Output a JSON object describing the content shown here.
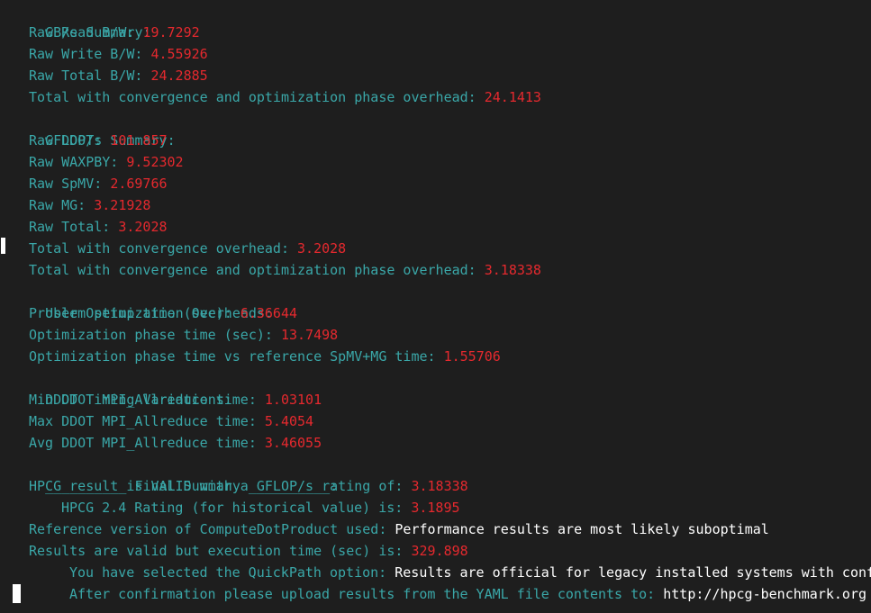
{
  "colors": {
    "background": "#1e1e1e",
    "key": "#3aa7a8",
    "value": "#e5292e",
    "plain": "#ffffff"
  },
  "lines": {
    "gbs_header": "GB/s Summary:",
    "raw_read_label": "Raw Read B/W: ",
    "raw_read_value": "19.7292",
    "raw_write_label": "Raw Write B/W: ",
    "raw_write_value": "4.55926",
    "raw_total_bw_label": "Raw Total B/W: ",
    "raw_total_bw_value": "24.2885",
    "gbs_total_opt_label": "Total with convergence and optimization phase overhead: ",
    "gbs_total_opt_value": "24.1413",
    "gflops_header": "GFLOP/s Summary:",
    "raw_ddot_label": "Raw DDOT: ",
    "raw_ddot_value": "101.857",
    "raw_waxpby_label": "Raw WAXPBY: ",
    "raw_waxpby_value": "9.52302",
    "raw_spmv_label": "Raw SpMV: ",
    "raw_spmv_value": "2.69766",
    "raw_mg_label": "Raw MG: ",
    "raw_mg_value": "3.21928",
    "raw_total_label": "Raw Total: ",
    "raw_total_value": "3.2028",
    "total_conv_label": "Total with convergence overhead: ",
    "total_conv_value": "3.2028",
    "gflops_total_opt_label": "Total with convergence and optimization phase overhead: ",
    "gflops_total_opt_value": "3.18338",
    "user_opt_header": "User Optimization Overheads:",
    "setup_time_label": "Problem setup time (sec): ",
    "setup_time_value": "6.36644",
    "opt_phase_label": "Optimization phase time (sec): ",
    "opt_phase_value": "13.7498",
    "opt_vs_ref_label": "Optimization phase time vs reference SpMV+MG time: ",
    "opt_vs_ref_value": "1.55706",
    "ddot_header": "DDOT Timing Variations:",
    "min_ddot_label": "Min DDOT MPI_Allreduce time: ",
    "min_ddot_value": "1.03101",
    "max_ddot_label": "Max DDOT MPI_Allreduce time: ",
    "max_ddot_value": "5.4054",
    "avg_ddot_label": "Avg DDOT MPI_Allreduce time: ",
    "avg_ddot_value": "3.46055",
    "final_header": "__________ Final Summary __________:",
    "result_valid_label": "HPCG result is VALID with a GFLOP/s rating of: ",
    "result_valid_value": "3.18338",
    "rating_label": "HPCG 2.4 Rating (for historical value) is: ",
    "rating_value": "3.1895",
    "ref_version_label": "Reference version of ComputeDotProduct used: ",
    "ref_version_value": "Performance results are most likely suboptimal",
    "exec_time_label": "Results are valid but execution time (sec) is: ",
    "exec_time_value": "329.898",
    "quickpath_label": "You have selected the QuickPath option: ",
    "quickpath_value": "Results are official for legacy installed systems with conf",
    "upload_label": "After confirmation please upload results from the YAML file contents to: ",
    "upload_value": "http://hpcg-benchmark.org"
  }
}
